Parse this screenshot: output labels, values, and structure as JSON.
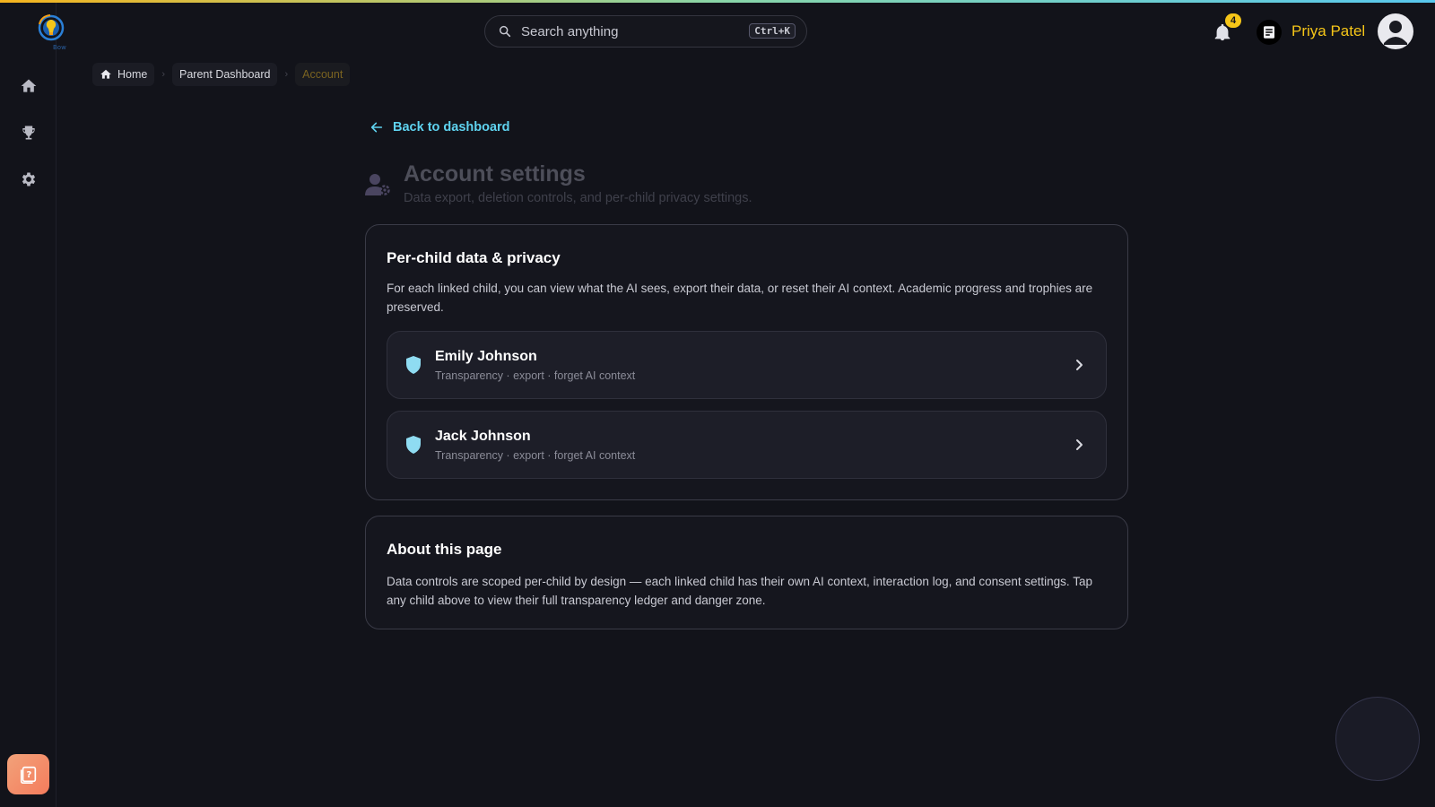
{
  "app": {
    "accent_color": "#f5c518",
    "link_color": "#5fd3f0",
    "logo_text": "Bow"
  },
  "header": {
    "search_placeholder": "Search anything",
    "search_shortcut": "Ctrl+K",
    "notification_count": "4",
    "user_name": "Priya Patel"
  },
  "sidebar": {
    "items": [
      {
        "name": "home",
        "icon": "home-icon"
      },
      {
        "name": "trophies",
        "icon": "trophy-icon"
      },
      {
        "name": "settings",
        "icon": "gear-icon"
      }
    ],
    "help_icon": "help-book-icon"
  },
  "breadcrumb": {
    "items": [
      "Home",
      "Parent Dashboard",
      "Account"
    ]
  },
  "back_link": "Back to dashboard",
  "page": {
    "title": "Account settings",
    "subtitle": "Data export, deletion controls, and per-child privacy settings."
  },
  "privacy_card": {
    "title": "Per-child data & privacy",
    "description": "For each linked child, you can view what the AI sees, export their data, or reset their AI context. Academic progress and trophies are preserved.",
    "children": [
      {
        "name": "Emily Johnson",
        "subtitle": "Transparency · export · forget AI context"
      },
      {
        "name": "Jack Johnson",
        "subtitle": "Transparency · export · forget AI context"
      }
    ]
  },
  "about_card": {
    "title": "About this page",
    "description": "Data controls are scoped per-child by design — each linked child has their own AI context, interaction log, and consent settings. Tap any child above to view their full transparency ledger and danger zone."
  }
}
